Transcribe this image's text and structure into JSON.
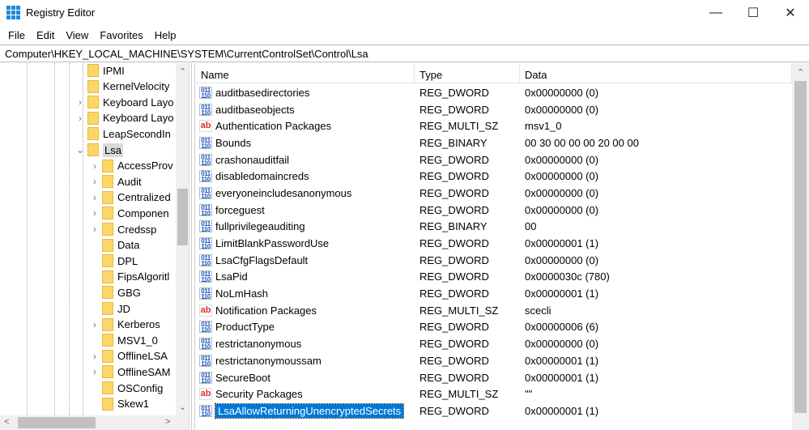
{
  "window": {
    "title": "Registry Editor",
    "minimize": "—",
    "maximize": "☐",
    "close": "✕"
  },
  "menu": [
    "File",
    "Edit",
    "View",
    "Favorites",
    "Help"
  ],
  "address": "Computer\\HKEY_LOCAL_MACHINE\\SYSTEM\\CurrentControlSet\\Control\\Lsa",
  "tree": {
    "siblings": [
      {
        "label": "IPMI",
        "exp": false
      },
      {
        "label": "KernelVelocity",
        "exp": false
      },
      {
        "label": "Keyboard Layo",
        "exp": true
      },
      {
        "label": "Keyboard Layo",
        "exp": true
      },
      {
        "label": "LeapSecondIn",
        "exp": false
      },
      {
        "label": "Lsa",
        "exp": "open"
      }
    ],
    "children": [
      {
        "label": "AccessProv",
        "exp": true
      },
      {
        "label": "Audit",
        "exp": true
      },
      {
        "label": "Centralized",
        "exp": true
      },
      {
        "label": "Componen",
        "exp": true
      },
      {
        "label": "Credssp",
        "exp": true
      },
      {
        "label": "Data",
        "exp": false
      },
      {
        "label": "DPL",
        "exp": false
      },
      {
        "label": "FipsAlgoritl",
        "exp": false
      },
      {
        "label": "GBG",
        "exp": false
      },
      {
        "label": "JD",
        "exp": false
      },
      {
        "label": "Kerberos",
        "exp": true
      },
      {
        "label": "MSV1_0",
        "exp": false
      },
      {
        "label": "OfflineLSA",
        "exp": true
      },
      {
        "label": "OfflineSAM",
        "exp": true
      },
      {
        "label": "OSConfig",
        "exp": false
      },
      {
        "label": "Skew1",
        "exp": false
      }
    ]
  },
  "columns": {
    "name": "Name",
    "type": "Type",
    "data": "Data"
  },
  "values": [
    {
      "name": "auditbasedirectories",
      "type": "REG_DWORD",
      "data": "0x00000000 (0)",
      "icon": "bin"
    },
    {
      "name": "auditbaseobjects",
      "type": "REG_DWORD",
      "data": "0x00000000 (0)",
      "icon": "bin"
    },
    {
      "name": "Authentication Packages",
      "type": "REG_MULTI_SZ",
      "data": "msv1_0",
      "icon": "str"
    },
    {
      "name": "Bounds",
      "type": "REG_BINARY",
      "data": "00 30 00 00 00 20 00 00",
      "icon": "bin"
    },
    {
      "name": "crashonauditfail",
      "type": "REG_DWORD",
      "data": "0x00000000 (0)",
      "icon": "bin"
    },
    {
      "name": "disabledomaincreds",
      "type": "REG_DWORD",
      "data": "0x00000000 (0)",
      "icon": "bin"
    },
    {
      "name": "everyoneincludesanonymous",
      "type": "REG_DWORD",
      "data": "0x00000000 (0)",
      "icon": "bin"
    },
    {
      "name": "forceguest",
      "type": "REG_DWORD",
      "data": "0x00000000 (0)",
      "icon": "bin"
    },
    {
      "name": "fullprivilegeauditing",
      "type": "REG_BINARY",
      "data": "00",
      "icon": "bin"
    },
    {
      "name": "LimitBlankPasswordUse",
      "type": "REG_DWORD",
      "data": "0x00000001 (1)",
      "icon": "bin"
    },
    {
      "name": "LsaCfgFlagsDefault",
      "type": "REG_DWORD",
      "data": "0x00000000 (0)",
      "icon": "bin"
    },
    {
      "name": "LsaPid",
      "type": "REG_DWORD",
      "data": "0x0000030c (780)",
      "icon": "bin"
    },
    {
      "name": "NoLmHash",
      "type": "REG_DWORD",
      "data": "0x00000001 (1)",
      "icon": "bin"
    },
    {
      "name": "Notification Packages",
      "type": "REG_MULTI_SZ",
      "data": "scecli",
      "icon": "str"
    },
    {
      "name": "ProductType",
      "type": "REG_DWORD",
      "data": "0x00000006 (6)",
      "icon": "bin"
    },
    {
      "name": "restrictanonymous",
      "type": "REG_DWORD",
      "data": "0x00000000 (0)",
      "icon": "bin"
    },
    {
      "name": "restrictanonymoussam",
      "type": "REG_DWORD",
      "data": "0x00000001 (1)",
      "icon": "bin"
    },
    {
      "name": "SecureBoot",
      "type": "REG_DWORD",
      "data": "0x00000001 (1)",
      "icon": "bin"
    },
    {
      "name": "Security Packages",
      "type": "REG_MULTI_SZ",
      "data": "\"\"",
      "icon": "str"
    },
    {
      "name": "LsaAllowReturningUnencryptedSecrets",
      "type": "REG_DWORD",
      "data": "0x00000001 (1)",
      "icon": "bin",
      "selected": true
    }
  ]
}
